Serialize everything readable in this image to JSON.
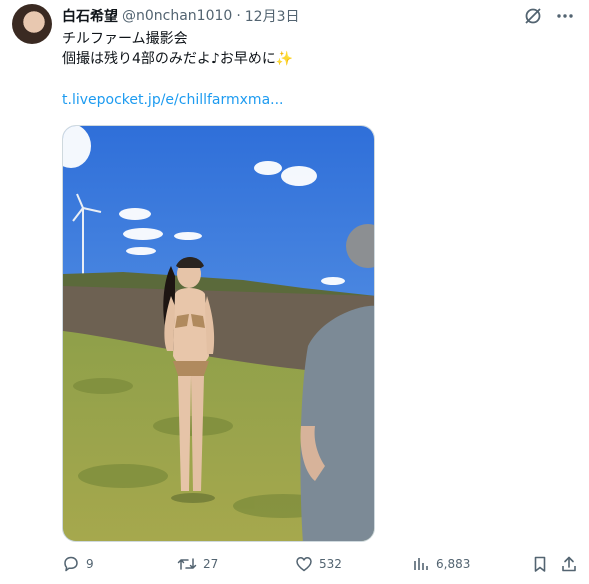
{
  "user": {
    "display_name": "白石希望",
    "handle": "@n0nchan1010",
    "separator": "·",
    "date": "12月3日"
  },
  "tweet": {
    "line1": "チルファーム撮影会",
    "line2": "個撮は残り4部のみだよ♪お早めに",
    "sparkle_emoji": "✨",
    "link": "t.livepocket.jp/e/chillfarmxma..."
  },
  "icons": {
    "grok": "grok-icon",
    "more": "more-icon",
    "reply": "reply-icon",
    "retweet": "retweet-icon",
    "like": "like-icon",
    "views": "views-icon",
    "bookmark": "bookmark-icon",
    "share": "share-icon"
  },
  "metrics": {
    "replies": "9",
    "retweets": "27",
    "likes": "532",
    "views": "6,883"
  },
  "colors": {
    "link": "#1d9bf0",
    "muted": "#536471",
    "text": "#0f1419"
  }
}
